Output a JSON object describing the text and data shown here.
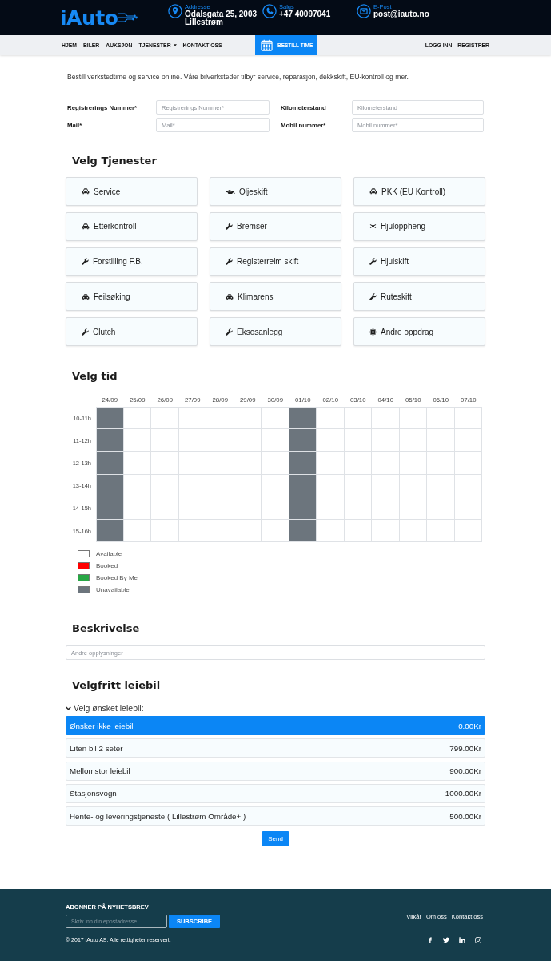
{
  "header": {
    "logo": "iAuto",
    "contacts": [
      {
        "kind": "address",
        "label": "Addresse",
        "value": "Odalsgata 25, 2003 Lillestrøm"
      },
      {
        "kind": "phone",
        "label": "Salgs",
        "value": "+47 40097041"
      },
      {
        "kind": "email",
        "label": "E-Post",
        "value": "post@iauto.no"
      }
    ]
  },
  "nav": {
    "items": [
      {
        "label": "HJEM",
        "dropdown": false
      },
      {
        "label": "BILER",
        "dropdown": false
      },
      {
        "label": "AUKSJON",
        "dropdown": false
      },
      {
        "label": "TJENESTER",
        "dropdown": true
      },
      {
        "label": "KONTAKT OSS",
        "dropdown": false
      }
    ],
    "cta": "BESTILL TIME",
    "account": [
      "LOGG INN",
      "REGISTRER"
    ]
  },
  "booking": {
    "intro": "Bestill verkstedtime og service online. Våre bilverksteder tilbyr service, reparasjon, dekkskift, EU-kontroll og mer.",
    "fields": [
      {
        "label": "Registrerings Nummer*",
        "placeholder": "Registrerings Nummer*"
      },
      {
        "label": "Kilometerstand",
        "placeholder": "Kilometerstand"
      },
      {
        "label": "Mail*",
        "placeholder": "Mail*"
      },
      {
        "label": "Mobil nummer*",
        "placeholder": "Mobil nummer*"
      }
    ]
  },
  "services": {
    "title": "Velg Tjenester",
    "items": [
      {
        "label": "Service",
        "kind": "car",
        "selected": false
      },
      {
        "label": "Oljeskift",
        "kind": "oil",
        "selected": false
      },
      {
        "label": "PKK (EU Kontroll)",
        "kind": "car",
        "selected": false
      },
      {
        "label": "Etterkontroll",
        "kind": "car",
        "selected": false
      },
      {
        "label": "Bremser",
        "kind": "wrench",
        "selected": false
      },
      {
        "label": "Hjuloppheng",
        "kind": "snowflake",
        "selected": false
      },
      {
        "label": "Forstilling F.B.",
        "kind": "wrench",
        "selected": false
      },
      {
        "label": "Registerreim skift",
        "kind": "wrench",
        "selected": false
      },
      {
        "label": "Hjulskift",
        "kind": "wrench",
        "selected": false
      },
      {
        "label": "Feilsøking",
        "kind": "car",
        "selected": false
      },
      {
        "label": "Klimarens",
        "kind": "car",
        "selected": false
      },
      {
        "label": "Ruteskift",
        "kind": "wrench",
        "selected": false
      },
      {
        "label": "Clutch",
        "kind": "wrench",
        "selected": false
      },
      {
        "label": "Eksosanlegg",
        "kind": "wrench",
        "selected": false
      },
      {
        "label": "Andre oppdrag",
        "kind": "cog",
        "selected": false
      }
    ]
  },
  "calendar": {
    "title": "Velg tid",
    "days": [
      "24/09",
      "25/09",
      "26/09",
      "27/09",
      "28/09",
      "29/09",
      "30/09",
      "01/10",
      "02/10",
      "03/10",
      "04/10",
      "05/10",
      "06/10",
      "07/10"
    ],
    "rows": [
      {
        "time": "10-11h",
        "cells": [
          {
            "kind": "unavailable"
          },
          {
            "kind": "available"
          },
          {
            "kind": "available"
          },
          {
            "kind": "available"
          },
          {
            "kind": "available"
          },
          {
            "kind": "available"
          },
          {
            "kind": "available"
          },
          {
            "kind": "unavailable"
          },
          {
            "kind": "available"
          },
          {
            "kind": "available"
          },
          {
            "kind": "available"
          },
          {
            "kind": "available"
          },
          {
            "kind": "available"
          },
          {
            "kind": "available"
          }
        ]
      },
      {
        "time": "11-12h",
        "cells": [
          {
            "kind": "unavailable"
          },
          {
            "kind": "available"
          },
          {
            "kind": "available"
          },
          {
            "kind": "available"
          },
          {
            "kind": "available"
          },
          {
            "kind": "available"
          },
          {
            "kind": "available"
          },
          {
            "kind": "unavailable"
          },
          {
            "kind": "available"
          },
          {
            "kind": "available"
          },
          {
            "kind": "available"
          },
          {
            "kind": "available"
          },
          {
            "kind": "available"
          },
          {
            "kind": "available"
          }
        ]
      },
      {
        "time": "12-13h",
        "cells": [
          {
            "kind": "unavailable"
          },
          {
            "kind": "available"
          },
          {
            "kind": "available"
          },
          {
            "kind": "available"
          },
          {
            "kind": "available"
          },
          {
            "kind": "available"
          },
          {
            "kind": "available"
          },
          {
            "kind": "unavailable"
          },
          {
            "kind": "available"
          },
          {
            "kind": "available"
          },
          {
            "kind": "available"
          },
          {
            "kind": "available"
          },
          {
            "kind": "available"
          },
          {
            "kind": "available"
          }
        ]
      },
      {
        "time": "13-14h",
        "cells": [
          {
            "kind": "unavailable"
          },
          {
            "kind": "available"
          },
          {
            "kind": "available"
          },
          {
            "kind": "available"
          },
          {
            "kind": "available"
          },
          {
            "kind": "available"
          },
          {
            "kind": "available"
          },
          {
            "kind": "unavailable"
          },
          {
            "kind": "available"
          },
          {
            "kind": "available"
          },
          {
            "kind": "available"
          },
          {
            "kind": "available"
          },
          {
            "kind": "available"
          },
          {
            "kind": "available"
          }
        ]
      },
      {
        "time": "14-15h",
        "cells": [
          {
            "kind": "unavailable"
          },
          {
            "kind": "available"
          },
          {
            "kind": "available"
          },
          {
            "kind": "available"
          },
          {
            "kind": "available"
          },
          {
            "kind": "available"
          },
          {
            "kind": "available"
          },
          {
            "kind": "unavailable"
          },
          {
            "kind": "available"
          },
          {
            "kind": "available"
          },
          {
            "kind": "available"
          },
          {
            "kind": "available"
          },
          {
            "kind": "available"
          },
          {
            "kind": "available"
          }
        ]
      },
      {
        "time": "15-16h",
        "cells": [
          {
            "kind": "unavailable"
          },
          {
            "kind": "available"
          },
          {
            "kind": "available"
          },
          {
            "kind": "available"
          },
          {
            "kind": "available"
          },
          {
            "kind": "available"
          },
          {
            "kind": "available"
          },
          {
            "kind": "unavailable"
          },
          {
            "kind": "available"
          },
          {
            "kind": "available"
          },
          {
            "kind": "available"
          },
          {
            "kind": "available"
          },
          {
            "kind": "available"
          },
          {
            "kind": "available"
          }
        ]
      }
    ],
    "legend": [
      {
        "label": "Available",
        "color": "#ffffff"
      },
      {
        "label": "Booked",
        "color": "#ff0000"
      },
      {
        "label": "Booked By Me",
        "color": "#28a745"
      },
      {
        "label": "Unavailable",
        "color": "#6c757d"
      }
    ]
  },
  "description": {
    "title": "Beskrivelse",
    "placeholder": "Andre opplysninger"
  },
  "rental": {
    "title": "Velgfritt leiebil",
    "toggle": "Velg ønsket leiebil:",
    "expanded": true,
    "options": [
      {
        "label": "Ønsker ikke leiebil",
        "price": "0.00Kr",
        "selected": true
      },
      {
        "label": "Liten bil 2 seter",
        "price": "799.00Kr",
        "selected": false
      },
      {
        "label": "Mellomstor leiebil",
        "price": "900.00Kr",
        "selected": false
      },
      {
        "label": "Stasjonsvogn",
        "price": "1000.00Kr",
        "selected": false
      },
      {
        "label": "Hente- og leveringstjeneste ( Lillestrøm Område+ )",
        "price": "500.00Kr",
        "selected": false
      }
    ]
  },
  "submit": "Send",
  "footer": {
    "newsletter_title": "ABONNER PÅ NYHETSBREV",
    "email_placeholder": "Skriv inn din epostadresse",
    "subscribe": "SUBSCRIBE",
    "copyright": "© 2017 iAuto AS. Alle rettigheter reservert.",
    "links": [
      "Vilkår",
      "Om oss",
      "Kontakt oss"
    ]
  }
}
